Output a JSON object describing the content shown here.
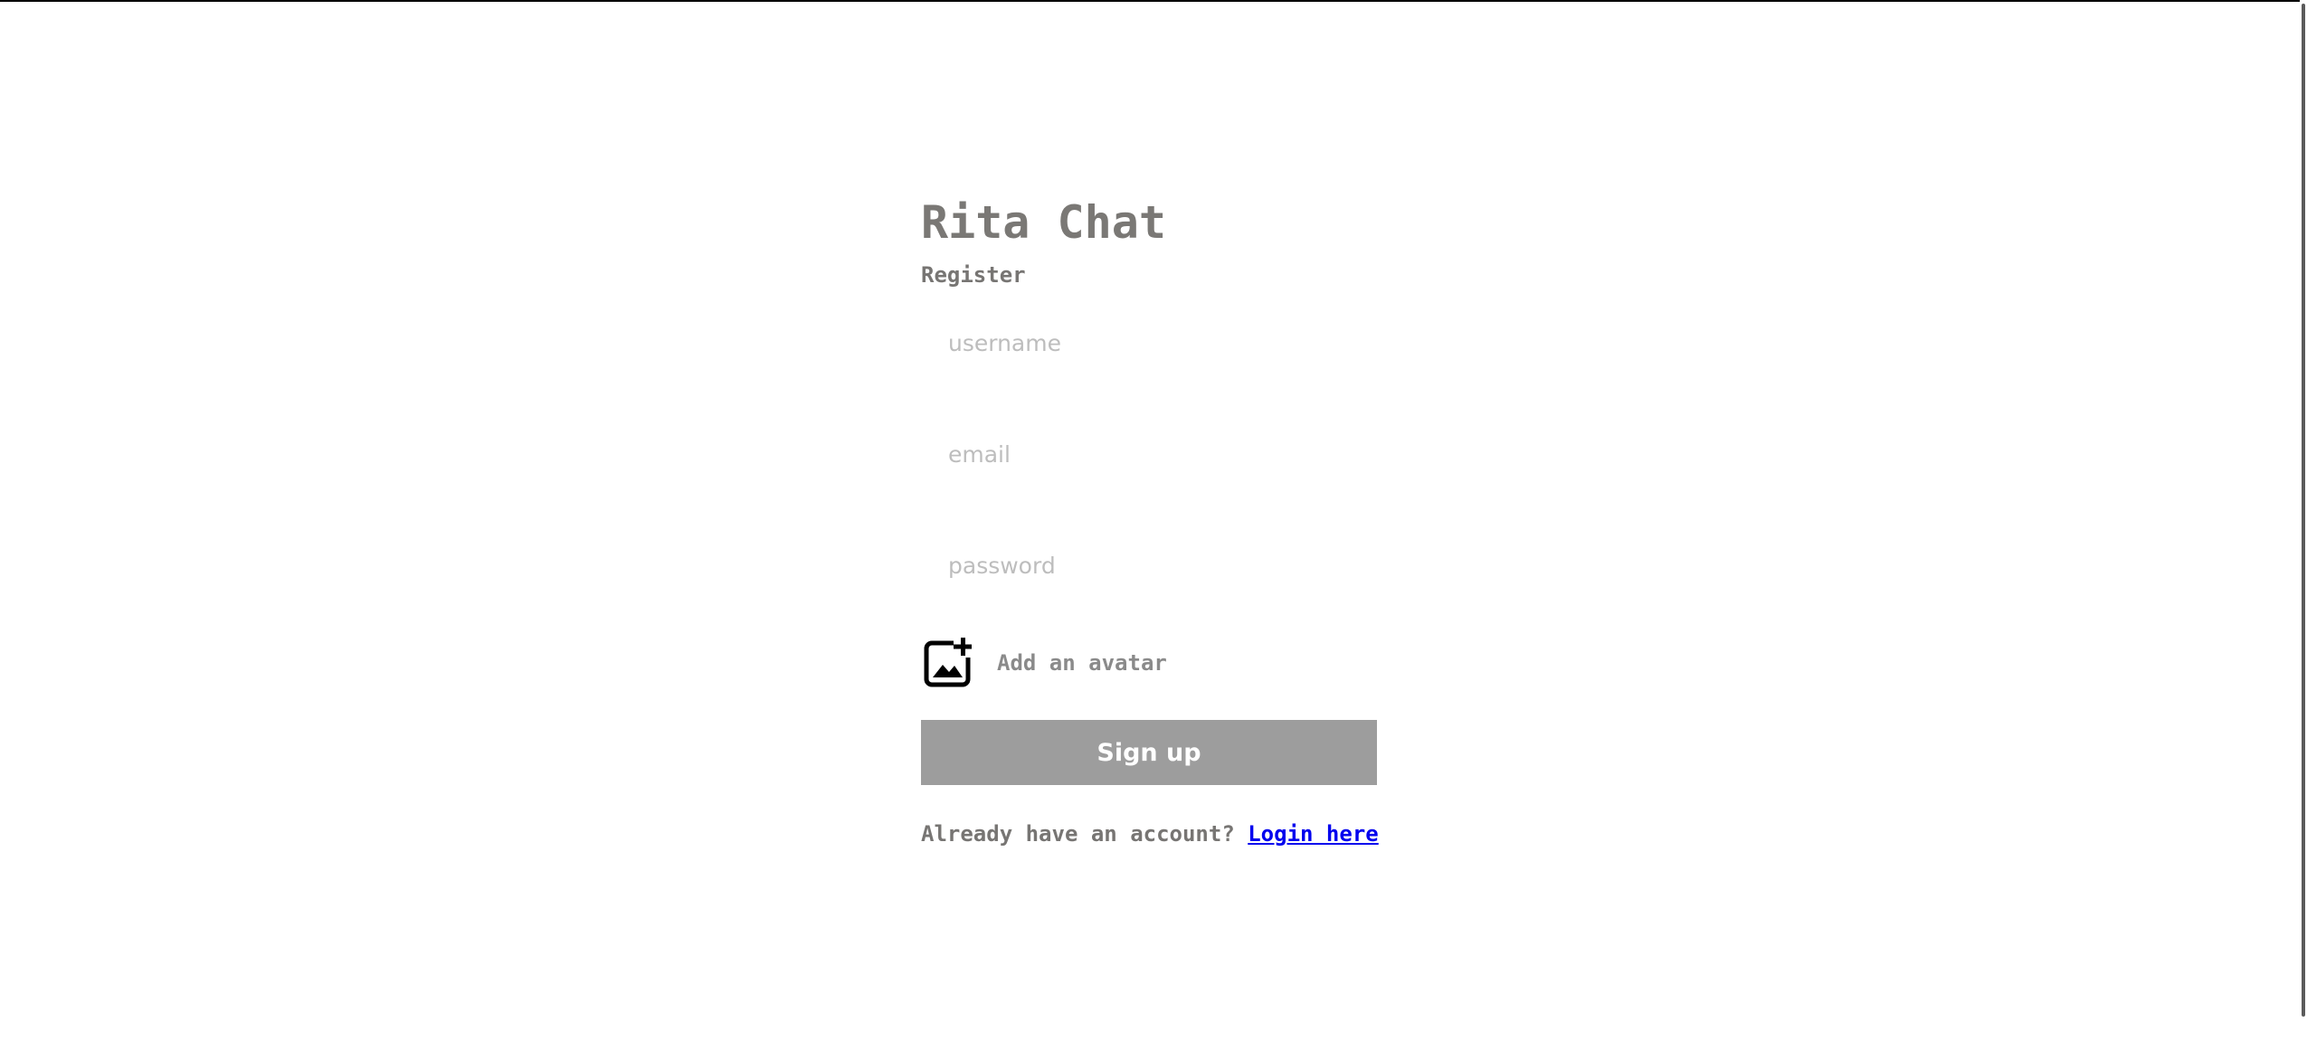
{
  "app": {
    "title": "Rita Chat",
    "subtitle": "Register"
  },
  "form": {
    "username": {
      "placeholder": "username",
      "value": ""
    },
    "email": {
      "placeholder": "email",
      "value": ""
    },
    "password": {
      "placeholder": "password",
      "value": ""
    },
    "avatar_label": "Add an avatar",
    "avatar_icon": "add-image-icon",
    "submit_label": "Sign up"
  },
  "footer": {
    "prompt": "Already have an account?",
    "link_label": "Login here"
  },
  "colors": {
    "text_muted": "#777573",
    "button_bg": "#9d9d9d",
    "link": "#0000ee",
    "placeholder": "#bdbdbd"
  }
}
